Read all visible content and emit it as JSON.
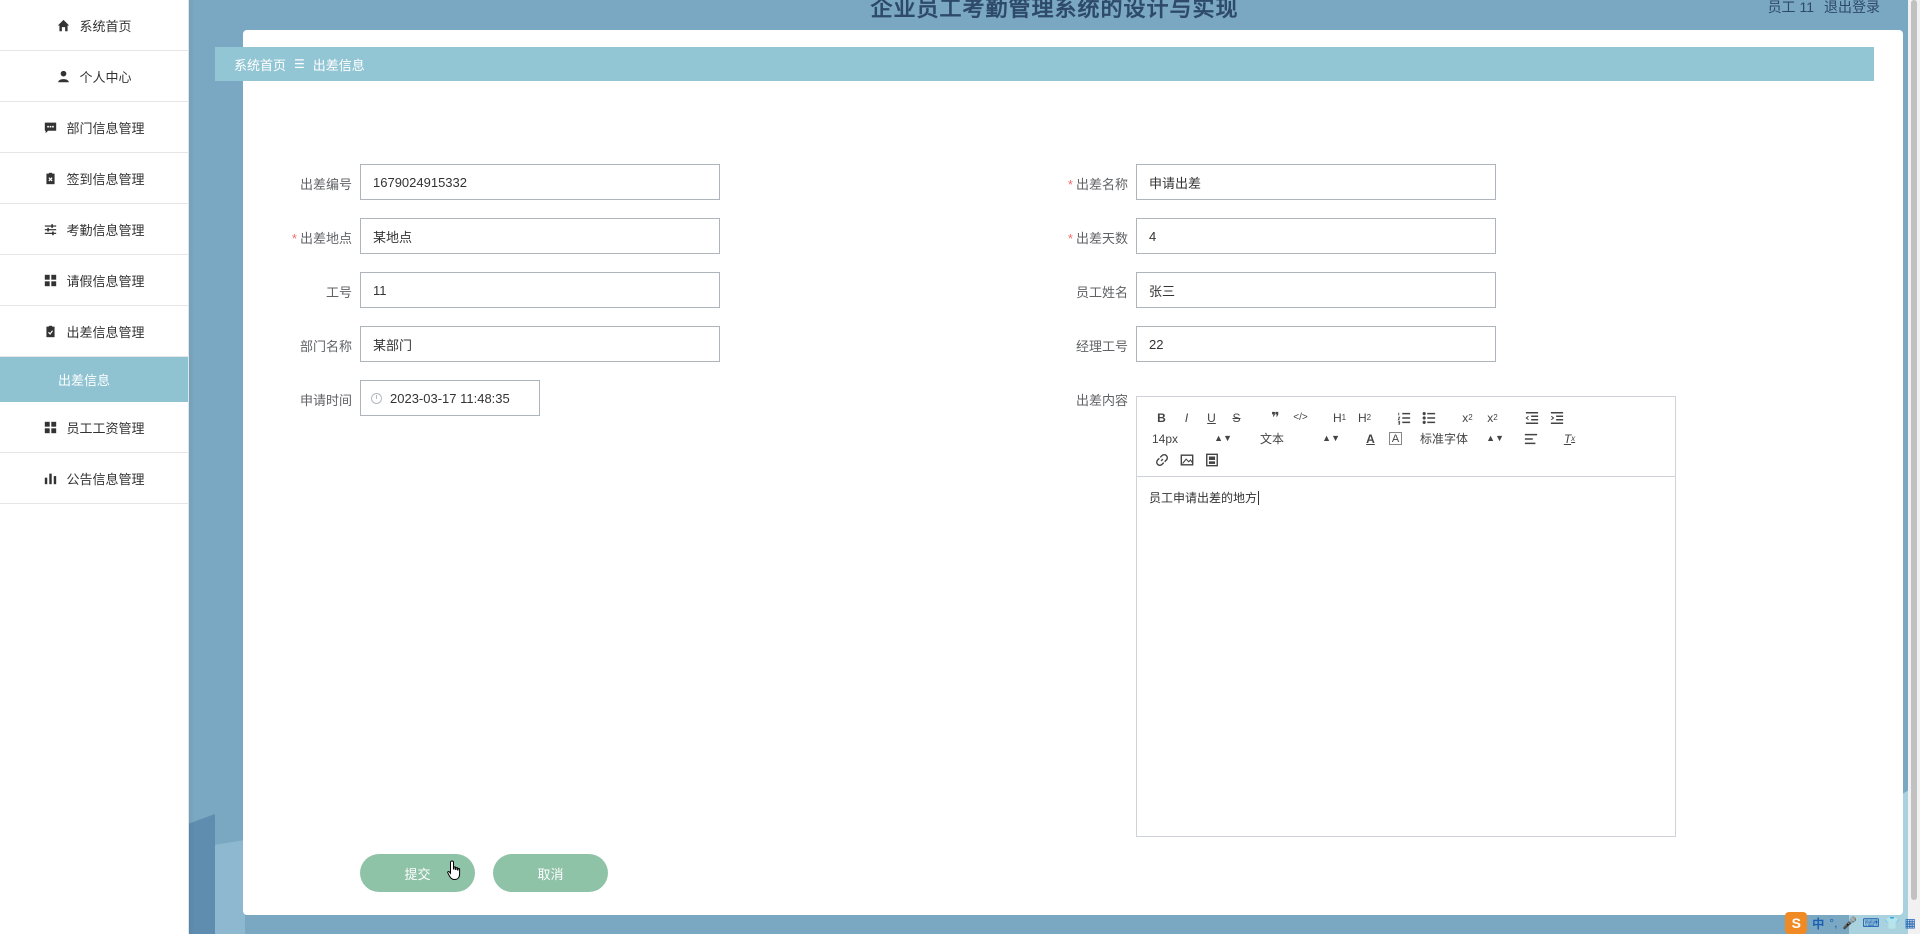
{
  "app": {
    "title": "企业员工考勤管理系统的设计与实现",
    "user_label": "员工 11",
    "logout_label": "退出登录"
  },
  "sidebar": {
    "items": [
      {
        "label": "系统首页",
        "icon": "home-icon"
      },
      {
        "label": "个人中心",
        "icon": "user-icon"
      },
      {
        "label": "部门信息管理",
        "icon": "message-icon"
      },
      {
        "label": "签到信息管理",
        "icon": "clipboard-x-icon"
      },
      {
        "label": "考勤信息管理",
        "icon": "sliders-icon"
      },
      {
        "label": "请假信息管理",
        "icon": "grid-icon"
      },
      {
        "label": "出差信息管理",
        "icon": "clipboard-check-icon"
      }
    ],
    "active_sub": "出差信息",
    "items_after": [
      {
        "label": "员工工资管理",
        "icon": "grid-icon"
      },
      {
        "label": "公告信息管理",
        "icon": "bar-chart-icon"
      }
    ]
  },
  "breadcrumb": {
    "home": "系统首页",
    "separator": "☰",
    "current": "出差信息"
  },
  "form": {
    "left": [
      {
        "label": "出差编号",
        "required": false,
        "value": "1679024915332"
      },
      {
        "label": "出差地点",
        "required": true,
        "value": "某地点"
      },
      {
        "label": "工号",
        "required": false,
        "value": "11"
      },
      {
        "label": "部门名称",
        "required": false,
        "value": "某部门"
      },
      {
        "label": "申请时间",
        "required": false,
        "value": "2023-03-17 11:48:35"
      }
    ],
    "right": [
      {
        "label": "出差名称",
        "required": true,
        "value": "申请出差"
      },
      {
        "label": "出差天数",
        "required": true,
        "value": "4"
      },
      {
        "label": "员工姓名",
        "required": false,
        "value": "张三"
      },
      {
        "label": "经理工号",
        "required": false,
        "value": "22"
      },
      {
        "label": "出差内容",
        "required": false
      }
    ],
    "required_mark": "*",
    "editor": {
      "font_size": "14px",
      "block_type": "文本",
      "font_family": "标准字体",
      "content": "员工申请出差的地方"
    },
    "submit_label": "提交",
    "cancel_label": "取消"
  },
  "tray": {
    "ime_logo": "S",
    "ime_lang": "中",
    "punct": "°,"
  },
  "colors": {
    "frame": "#7aa7c1",
    "breadcrumb": "#93c6d5",
    "active_sub": "#8fc3d2",
    "button": "#8fc3a8",
    "required": "#f56c6c"
  }
}
